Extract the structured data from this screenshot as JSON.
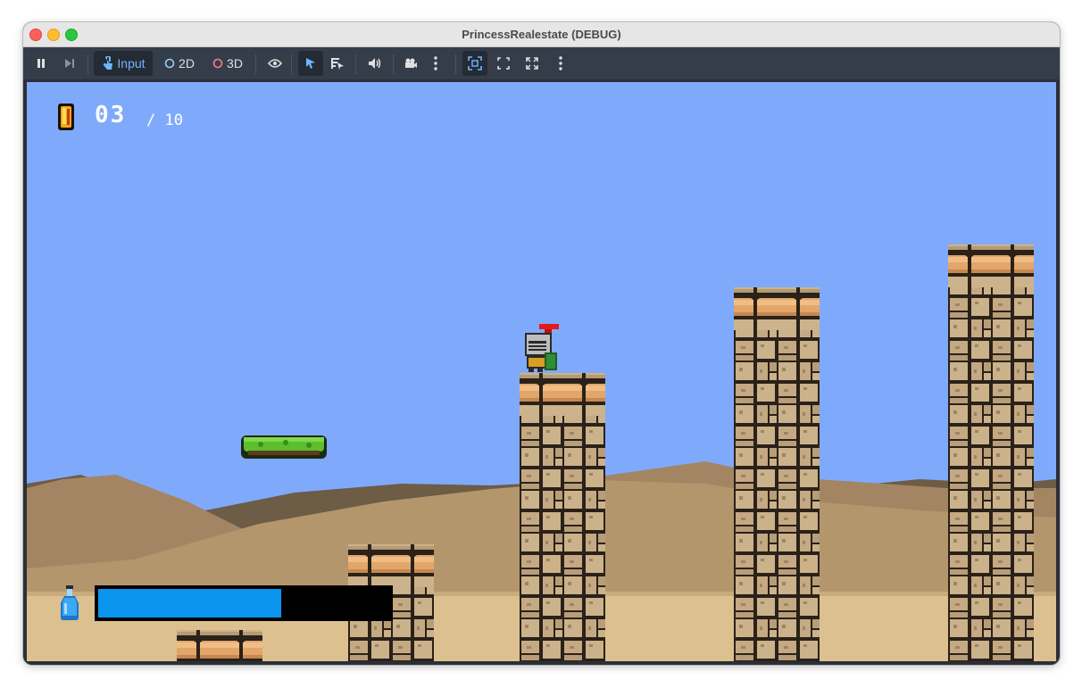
{
  "window": {
    "title": "PrincessRealestate (DEBUG)"
  },
  "toolbar": {
    "pause_icon": "pause-icon",
    "step_icon": "step-forward-icon",
    "input_label": "Input",
    "mode_2d_label": "2D",
    "mode_3d_label": "3D",
    "colors": {
      "input_accent": "#6fb6ff",
      "mode_2d": "#8fd0ff",
      "mode_3d": "#ff7d7d"
    }
  },
  "hud": {
    "coins_collected": "03",
    "coins_total": "/ 10",
    "health_fraction": 0.63,
    "health_color": "#0b95ef"
  },
  "scene": {
    "sky_color": "#7faafc",
    "sand_color": "#dcc08f",
    "player": "knight",
    "platform": "grass-platform"
  }
}
